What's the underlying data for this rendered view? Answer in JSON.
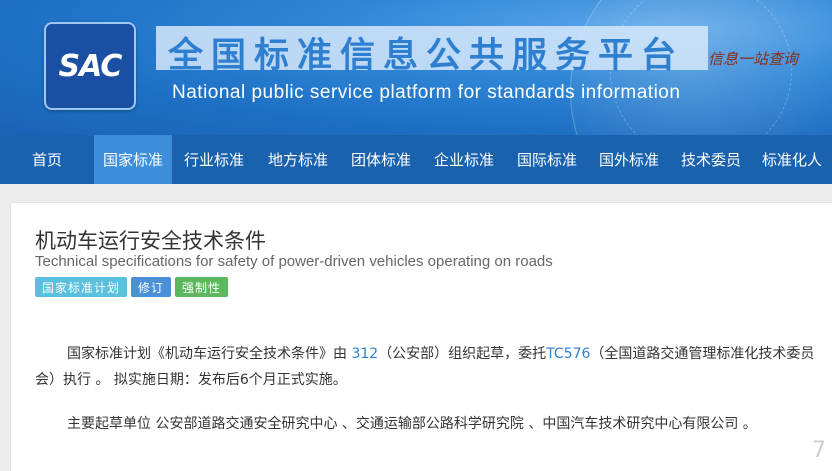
{
  "header": {
    "logo_text": "SAC",
    "title_cn": "全国标准信息公共服务平台",
    "title_en": "National public service platform  for standards information",
    "slogan": "信息一站查询"
  },
  "nav": {
    "items": [
      {
        "label": "首页",
        "active": false
      },
      {
        "label": "国家标准",
        "active": true
      },
      {
        "label": "行业标准",
        "active": false
      },
      {
        "label": "地方标准",
        "active": false
      },
      {
        "label": "团体标准",
        "active": false
      },
      {
        "label": "企业标准",
        "active": false
      },
      {
        "label": "国际标准",
        "active": false
      },
      {
        "label": "国外标准",
        "active": false
      },
      {
        "label": "技术委员",
        "active": false
      },
      {
        "label": "标准化人",
        "active": false
      }
    ]
  },
  "standard": {
    "title_cn": "机动车运行安全技术条件",
    "title_en": "Technical specifications for safety of power-driven vehicles operating on roads",
    "badges": [
      "国家标准计划",
      "修订",
      "强制性"
    ],
    "p1_a": "国家标准计划《机动车运行安全技术条件》由 ",
    "p1_link1": "312",
    "p1_b": "（公安部）组织起草，委托",
    "p1_link2": "TC576",
    "p1_c": "（全国道路交通管理标准化技术委员会）执行 。 拟实施日期：发布后6个月正式实施。",
    "p2": "主要起草单位 公安部道路交通安全研究中心 、交通运输部公路科学研究院 、中国汽车技术研究中心有限公司 。"
  },
  "watermark": "7"
}
